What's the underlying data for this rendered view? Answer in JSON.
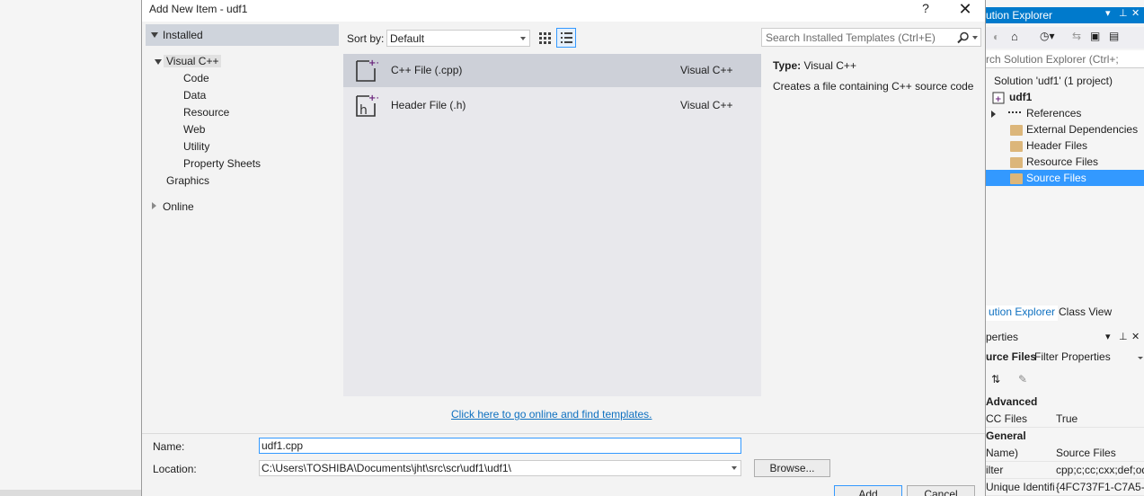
{
  "dialog": {
    "title": "Add New Item - udf1",
    "help": "?",
    "close": "✕"
  },
  "tree": {
    "installed": "Installed",
    "visual_cpp": "Visual C++",
    "children": [
      "Code",
      "Data",
      "Resource",
      "Web",
      "Utility",
      "Property Sheets"
    ],
    "graphics": "Graphics",
    "online": "Online"
  },
  "toolbar": {
    "sort_label": "Sort by:",
    "sort_value": "Default",
    "search_placeholder": "Search Installed Templates (Ctrl+E)"
  },
  "templates": [
    {
      "name": "C++ File (.cpp)",
      "lang": "Visual C++",
      "selected": true
    },
    {
      "name": "Header File (.h)",
      "lang": "Visual C++",
      "selected": false
    }
  ],
  "details": {
    "type_label": "Type:",
    "type_value": "Visual C++",
    "description": "Creates a file containing C++ source code"
  },
  "online_link": "Click here to go online and find templates.",
  "form": {
    "name_label": "Name:",
    "name_value": "udf1.cpp",
    "location_label": "Location:",
    "location_value": "C:\\Users\\TOSHIBA\\Documents\\jht\\src\\scr\\udf1\\udf1\\",
    "browse": "Browse...",
    "add": "Add",
    "cancel": "Cancel"
  },
  "solution_explorer": {
    "title": "ution Explorer",
    "search_placeholder": "rch Solution Explorer (Ctrl+;",
    "solution": "Solution 'udf1' (1 project)",
    "project": "udf1",
    "nodes": [
      "References",
      "External Dependencies",
      "Header Files",
      "Resource Files",
      "Source Files"
    ],
    "tab_explorer": "ution Explorer",
    "tab_class": "Class View"
  },
  "properties": {
    "title": "perties",
    "object": "urce Files",
    "object_type": "Filter Properties",
    "cat_advanced": "Advanced",
    "cat_general": "General",
    "rows": [
      {
        "k": "CC Files",
        "v": "True"
      },
      {
        "k": "Name)",
        "v": "Source Files"
      },
      {
        "k": "ilter",
        "v": "cpp;c;cc;cxx;def;od"
      },
      {
        "k": "Unique Identifi",
        "v": "{4FC737F1-C7A5-4"
      }
    ]
  }
}
